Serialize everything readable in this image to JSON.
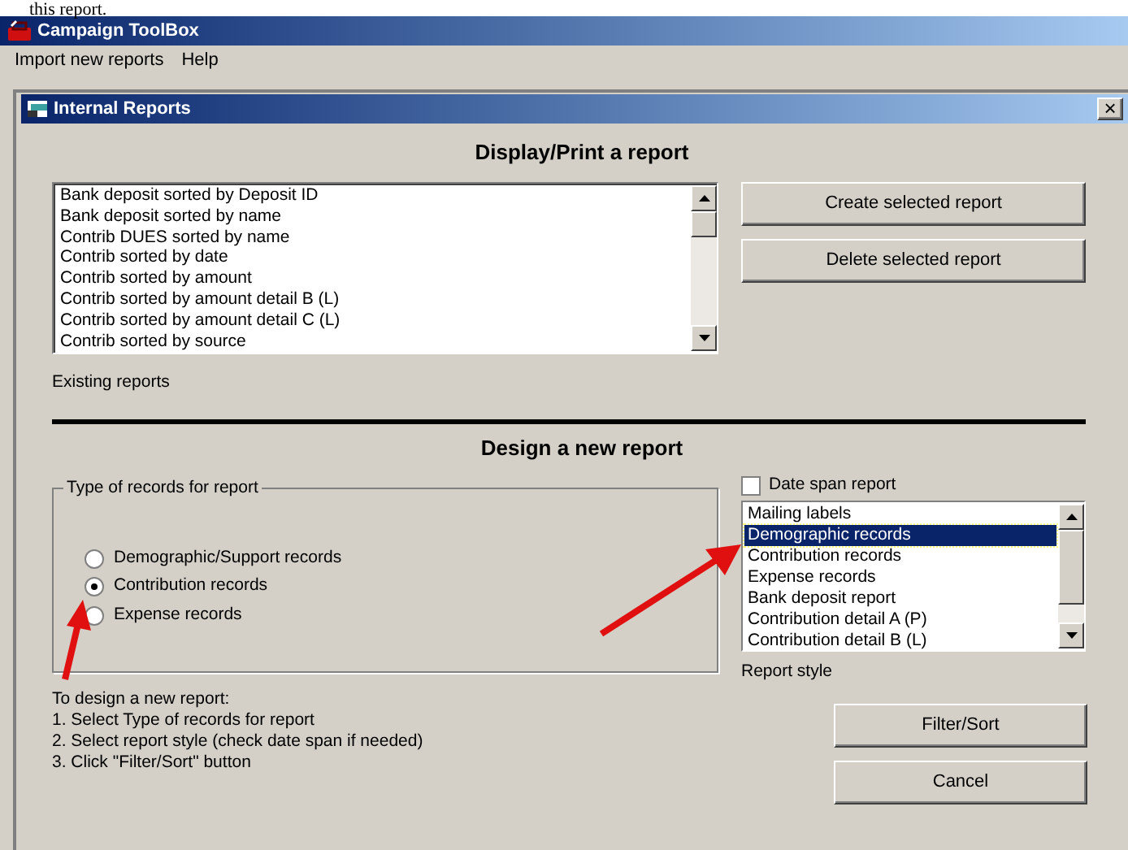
{
  "document_text": "this report.",
  "app": {
    "title": "Campaign ToolBox",
    "menu": [
      "Import new reports",
      "Help"
    ]
  },
  "window": {
    "title": "Internal Reports",
    "close": "×"
  },
  "display": {
    "heading": "Display/Print a report",
    "reports": [
      "Bank deposit sorted by Deposit ID",
      "Bank deposit sorted by name",
      "Contrib DUES sorted by name",
      "Contrib sorted by date",
      "Contrib sorted by amount",
      "Contrib sorted by amount detail B (L)",
      "Contrib sorted by amount detail C (L)",
      "Contrib sorted by source"
    ],
    "list_label": "Existing reports",
    "buttons": [
      "Create selected report",
      "Delete selected report"
    ]
  },
  "design": {
    "heading": "Design a new report",
    "group_title": "Type of records for report",
    "record_types": [
      {
        "label": "Demographic/Support records",
        "selected": false
      },
      {
        "label": "Contribution records",
        "selected": true
      },
      {
        "label": "Expense records",
        "selected": false
      }
    ],
    "date_span": {
      "label": "Date span report",
      "checked": false
    },
    "styles": [
      {
        "label": "Mailing labels",
        "selected": false
      },
      {
        "label": "Demographic records",
        "selected": true
      },
      {
        "label": "Contribution records",
        "selected": false
      },
      {
        "label": "Expense records",
        "selected": false
      },
      {
        "label": "Bank deposit report",
        "selected": false
      },
      {
        "label": "Contribution detail A (P)",
        "selected": false
      },
      {
        "label": "Contribution detail B (L)",
        "selected": false
      }
    ],
    "style_label": "Report style",
    "instructions": [
      "To design a new report:",
      "1. Select Type of records for report",
      "2. Select report style (check date span if needed)",
      "3. Click \"Filter/Sort\" button"
    ],
    "buttons": [
      "Filter/Sort",
      "Cancel"
    ]
  }
}
